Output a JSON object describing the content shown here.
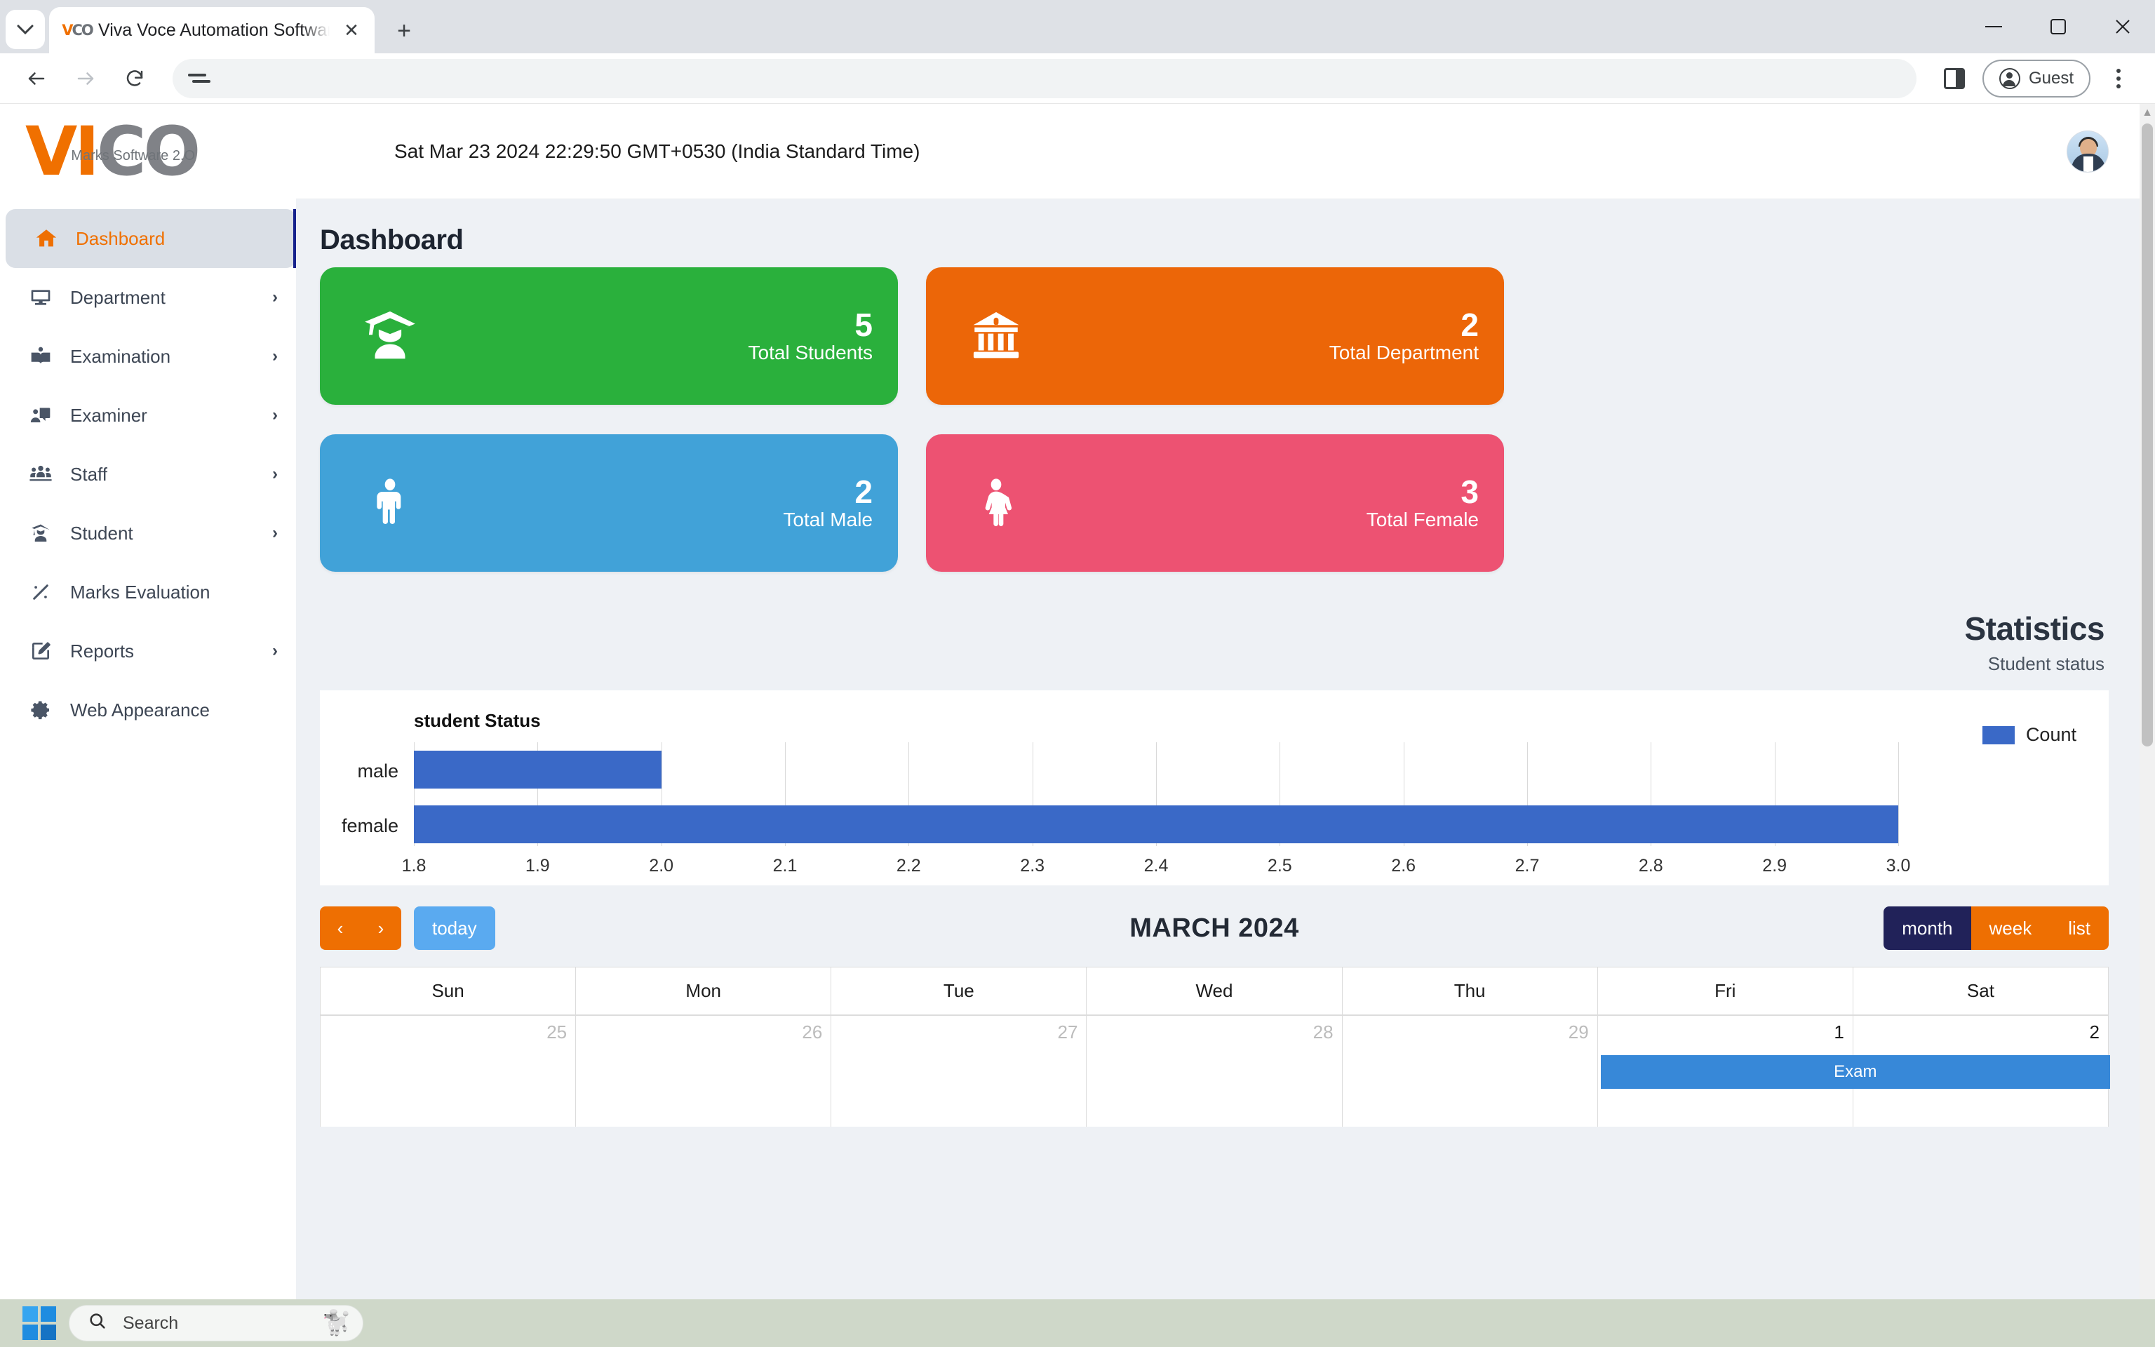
{
  "browser": {
    "tab": {
      "title": "Viva Voce Automation Software",
      "favicon": "vico-favicon"
    },
    "new_tab_label": "+",
    "close_label": "✕",
    "window_controls": {
      "minimize": "—",
      "maximize": "❐",
      "close": "✕"
    },
    "toolbar": {
      "back": "←",
      "forward": "→",
      "reload": "⟳",
      "omnibox_value": "",
      "omnibox_placeholder": "",
      "split_label": "",
      "profile_label": "Guest",
      "menu_label": ""
    }
  },
  "sidebar": {
    "logo": {
      "vi": "VI",
      "co": "CO",
      "tagline": "Marks Software 2.O"
    },
    "items": [
      {
        "label": "Dashboard",
        "icon": "home-icon",
        "active": true,
        "chevron": ""
      },
      {
        "label": "Department",
        "icon": "monitor-icon",
        "active": false,
        "chevron": "›"
      },
      {
        "label": "Examination",
        "icon": "book-user-icon",
        "active": false,
        "chevron": "›"
      },
      {
        "label": "Examiner",
        "icon": "presenter-icon",
        "active": false,
        "chevron": "›"
      },
      {
        "label": "Staff",
        "icon": "group-icon",
        "active": false,
        "chevron": "›"
      },
      {
        "label": "Student",
        "icon": "graduate-icon",
        "active": false,
        "chevron": "›"
      },
      {
        "label": "Marks Evaluation",
        "icon": "percent-icon",
        "active": false,
        "chevron": ""
      },
      {
        "label": "Reports",
        "icon": "edit-icon",
        "active": false,
        "chevron": "›"
      },
      {
        "label": "Web Appearance",
        "icon": "gear-icon",
        "active": false,
        "chevron": ""
      }
    ]
  },
  "topbar": {
    "datetime": "Sat Mar 23 2024 22:29:50 GMT+0530 (India Standard Time)",
    "avatar": "user-avatar"
  },
  "main": {
    "page_title": "Dashboard",
    "cards": [
      {
        "value": "5",
        "label": "Total Students",
        "color": "#2ab03c",
        "icon": "graduate-icon"
      },
      {
        "value": "2",
        "label": "Total Department",
        "color": "#ec6608",
        "icon": "bank-icon"
      },
      {
        "value": "2",
        "label": "Total Male",
        "color": "#41a2d8",
        "icon": "male-icon"
      },
      {
        "value": "3",
        "label": "Total Female",
        "color": "#ed5272",
        "icon": "female-icon"
      }
    ],
    "statistics": {
      "title": "Statistics",
      "subtitle": "Student status"
    }
  },
  "chart_data": {
    "type": "bar",
    "orientation": "horizontal",
    "title": "student Status",
    "categories": [
      "male",
      "female"
    ],
    "series": [
      {
        "name": "Count",
        "values": [
          2,
          3
        ],
        "color": "#3a69c7"
      }
    ],
    "xlabel": "",
    "ylabel": "",
    "xlim": [
      1.8,
      3.0
    ],
    "xticks": [
      "1.8",
      "1.9",
      "2.0",
      "2.1",
      "2.2",
      "2.3",
      "2.4",
      "2.5",
      "2.6",
      "2.7",
      "2.8",
      "2.9",
      "3.0"
    ],
    "grid": true,
    "legend": {
      "position": "right",
      "entries": [
        "Count"
      ]
    }
  },
  "calendar": {
    "title": "MARCH 2024",
    "nav": {
      "prev": "‹",
      "next": "›",
      "today": "today"
    },
    "views": [
      {
        "label": "month",
        "active": true
      },
      {
        "label": "week",
        "active": false
      },
      {
        "label": "list",
        "active": false
      }
    ],
    "day_headers": [
      "Sun",
      "Mon",
      "Tue",
      "Wed",
      "Thu",
      "Fri",
      "Sat"
    ],
    "week_row": [
      {
        "date": "25",
        "muted": true,
        "event": null
      },
      {
        "date": "26",
        "muted": true,
        "event": null
      },
      {
        "date": "27",
        "muted": true,
        "event": null
      },
      {
        "date": "28",
        "muted": true,
        "event": null
      },
      {
        "date": "29",
        "muted": true,
        "event": null
      },
      {
        "date": "1",
        "muted": false,
        "event": "Exam"
      },
      {
        "date": "2",
        "muted": false,
        "event": null
      }
    ]
  },
  "taskbar": {
    "start": "windows-start-icon",
    "search_placeholder": "Search",
    "widget": "dog-widget-icon"
  }
}
